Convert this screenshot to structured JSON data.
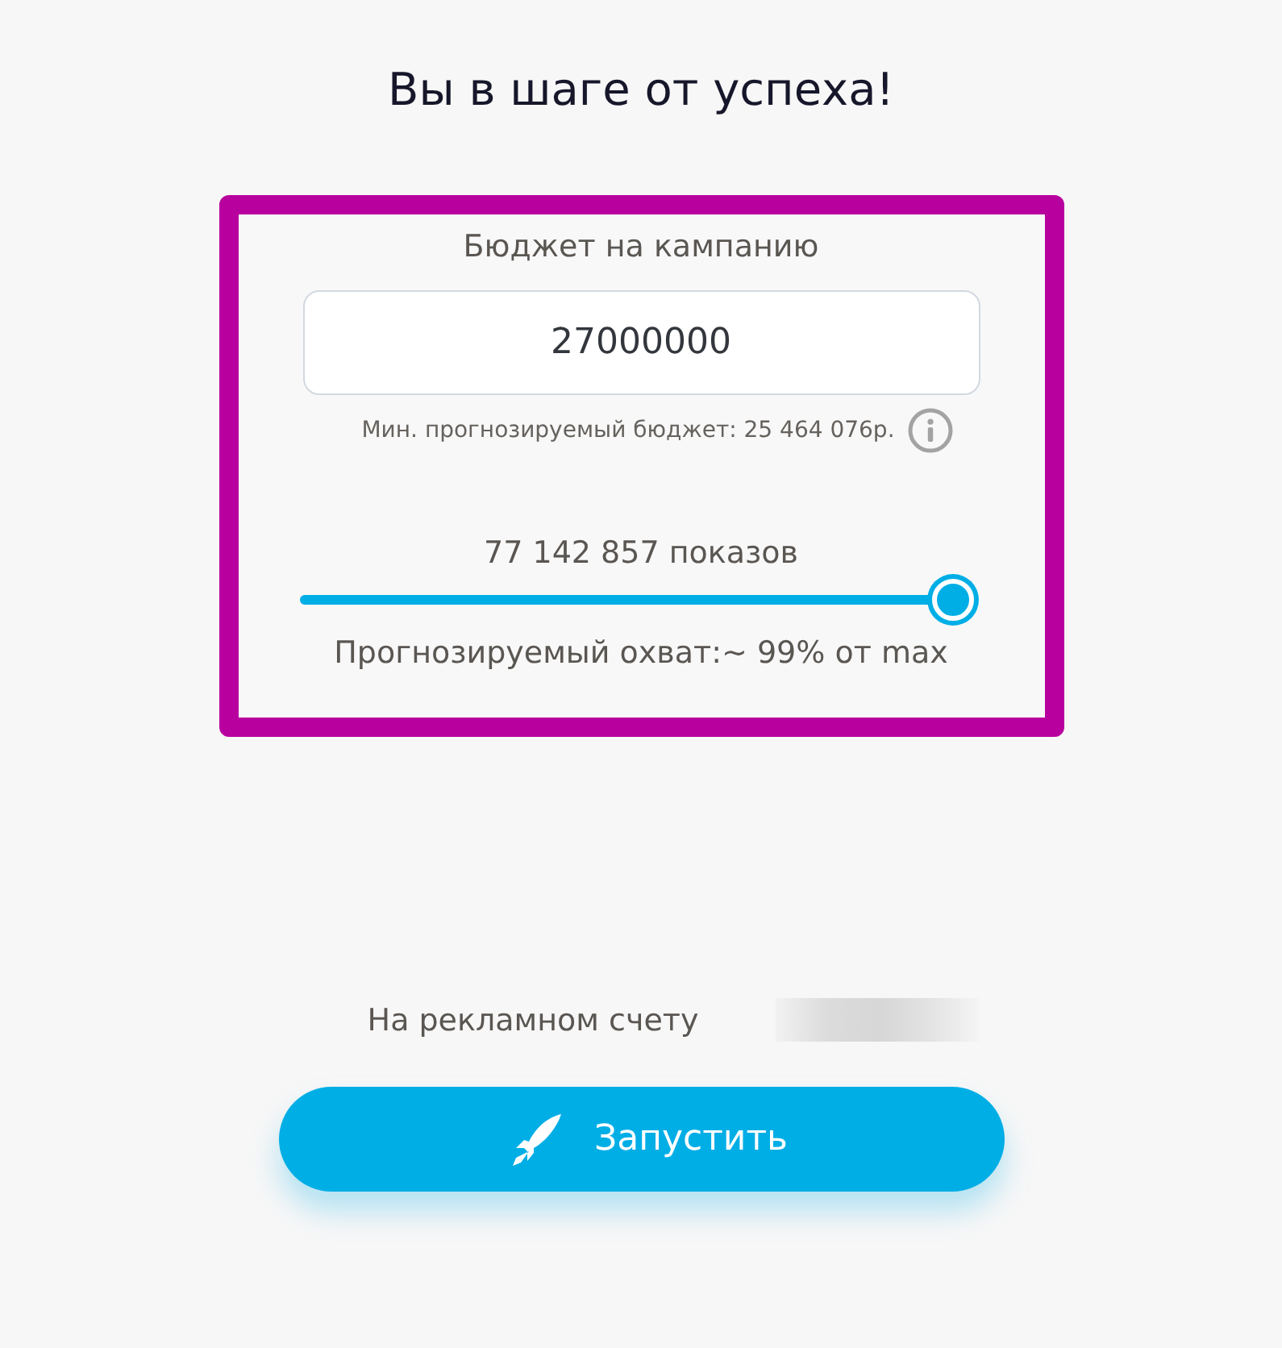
{
  "title": "Вы в шаге от успеха!",
  "budget": {
    "label": "Бюджет на кампанию",
    "value": "27000000",
    "min_note": "Мин. прогнозируемый бюджет: 25 464 076р."
  },
  "impressions": {
    "label": "77 142 857 показов",
    "level": 1,
    "reach": "Прогнозируемый охват:~ 99% от max"
  },
  "balance": {
    "label": "На рекламном счету"
  },
  "launch_button": {
    "label": "Запустить"
  }
}
